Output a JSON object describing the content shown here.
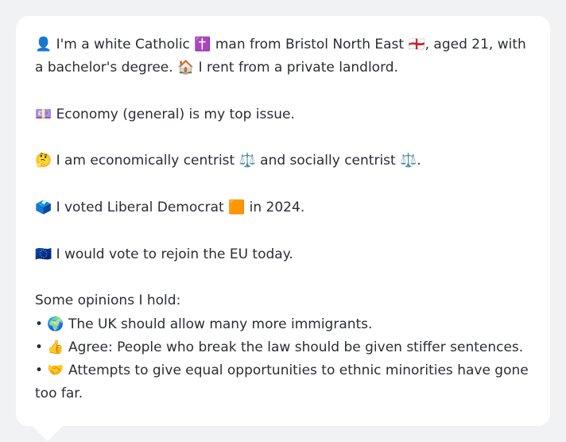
{
  "profile": {
    "line1_a": "👤 I'm a white Catholic ✝️ man from Bristol North East 🏴󠁧󠁢󠁥󠁮󠁧󠁿, aged 21, with a bachelor's degree. 🏠 I rent from a private landlord.",
    "top_issue": "💷 Economy (general) is my top issue.",
    "ideology": "🤔 I am economically centrist ⚖️ and socially centrist ⚖️.",
    "vote_2024": "🗳️ I voted Liberal Democrat 🟧 in 2024.",
    "eu": "🇪🇺 I would vote to rejoin the EU today."
  },
  "opinions": {
    "heading": "Some opinions I hold:",
    "items": [
      "• 🌍 The UK should allow many more immigrants.",
      "• 👍 Agree: People who break the law should be given stiffer sentences.",
      "• 🤝 Attempts to give equal opportunities to ethnic minorities have gone too far."
    ]
  }
}
